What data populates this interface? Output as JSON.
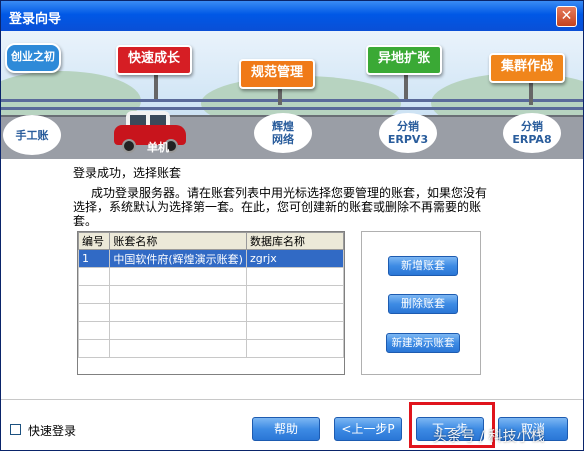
{
  "window": {
    "title": "登录向导",
    "close_glyph": "✕"
  },
  "banner": {
    "corner_label": "创业之初",
    "signs": [
      {
        "label": "快速成长",
        "color": "#d61e24"
      },
      {
        "label": "规范管理",
        "color": "#f07a18"
      },
      {
        "label": "异地扩张",
        "color": "#3aa935"
      },
      {
        "label": "集群作战",
        "color": "#f0851b"
      }
    ],
    "stops": [
      {
        "line1": "手工账",
        "line2": ""
      },
      {
        "line1": "辉煌",
        "line2": "网络"
      },
      {
        "line1": "分销",
        "line2": "ERPV3"
      },
      {
        "line1": "分销",
        "line2": "ERPA8"
      }
    ],
    "car_label": "单机"
  },
  "content": {
    "status": "登录成功，选择账套",
    "description": "成功登录服务器。请在账套列表中用光标选择您要管理的账套，如果您没有选择，系统默认为选择第一套。在此，您可创建新的账套或删除不再需要的账套。"
  },
  "grid": {
    "columns": [
      "编号",
      "账套名称",
      "数据库名称"
    ],
    "rows": [
      [
        "1",
        "中国软件府(辉煌演示账套)",
        "zgrjx"
      ],
      [
        "",
        "",
        ""
      ],
      [
        "",
        "",
        ""
      ],
      [
        "",
        "",
        ""
      ],
      [
        "",
        "",
        ""
      ],
      [
        "",
        "",
        ""
      ]
    ]
  },
  "side_buttons": {
    "new": "新增账套",
    "delete": "删除账套",
    "new_demo": "新建演示账套"
  },
  "footer": {
    "quick_login": "快速登录",
    "help": "帮助",
    "prev": "<上一步P",
    "next": "下一步",
    "cancel": "取消",
    "watermark": "头条号 / 科技小栈"
  },
  "colors": {
    "titlebar": "#0058e6",
    "selection": "#316ac5",
    "highlight": "#e0141c"
  }
}
